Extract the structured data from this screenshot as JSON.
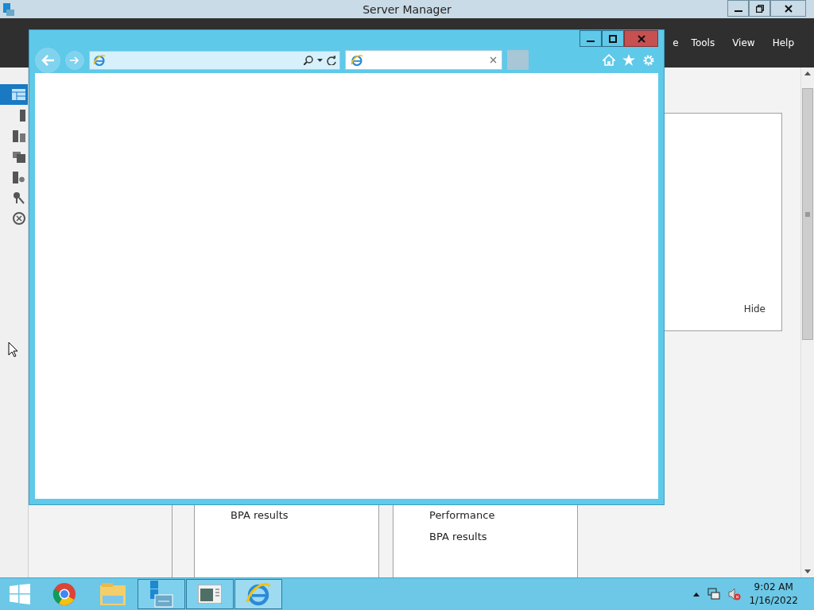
{
  "server_manager": {
    "title": "Server Manager",
    "menu": [
      "e",
      "Tools",
      "View",
      "Help"
    ],
    "nav": [
      {
        "kind": "dashboard",
        "selected": true
      },
      {
        "kind": "server",
        "selected": false
      },
      {
        "kind": "servers",
        "selected": false
      },
      {
        "kind": "files",
        "selected": false
      },
      {
        "kind": "iis",
        "selected": false
      },
      {
        "kind": "tools",
        "selected": false
      },
      {
        "kind": "remote",
        "selected": false
      }
    ],
    "welcome_panel": {
      "hide_link": "Hide"
    },
    "tiles": [
      {
        "rows": [
          "BPA results"
        ]
      },
      {
        "rows": [
          "Performance",
          "BPA results"
        ]
      }
    ]
  },
  "browser": {
    "tabs": [
      {
        "selected": true
      }
    ]
  },
  "taskbar": {
    "apps": [
      {
        "kind": "start",
        "running": false,
        "active": false
      },
      {
        "kind": "chrome",
        "running": false,
        "active": false
      },
      {
        "kind": "explorer",
        "running": false,
        "active": false
      },
      {
        "kind": "servermanager",
        "running": true,
        "active": false
      },
      {
        "kind": "window",
        "running": true,
        "active": false
      },
      {
        "kind": "ie",
        "running": true,
        "active": true
      }
    ],
    "time": "9:02 AM",
    "date": "1/16/2022"
  }
}
